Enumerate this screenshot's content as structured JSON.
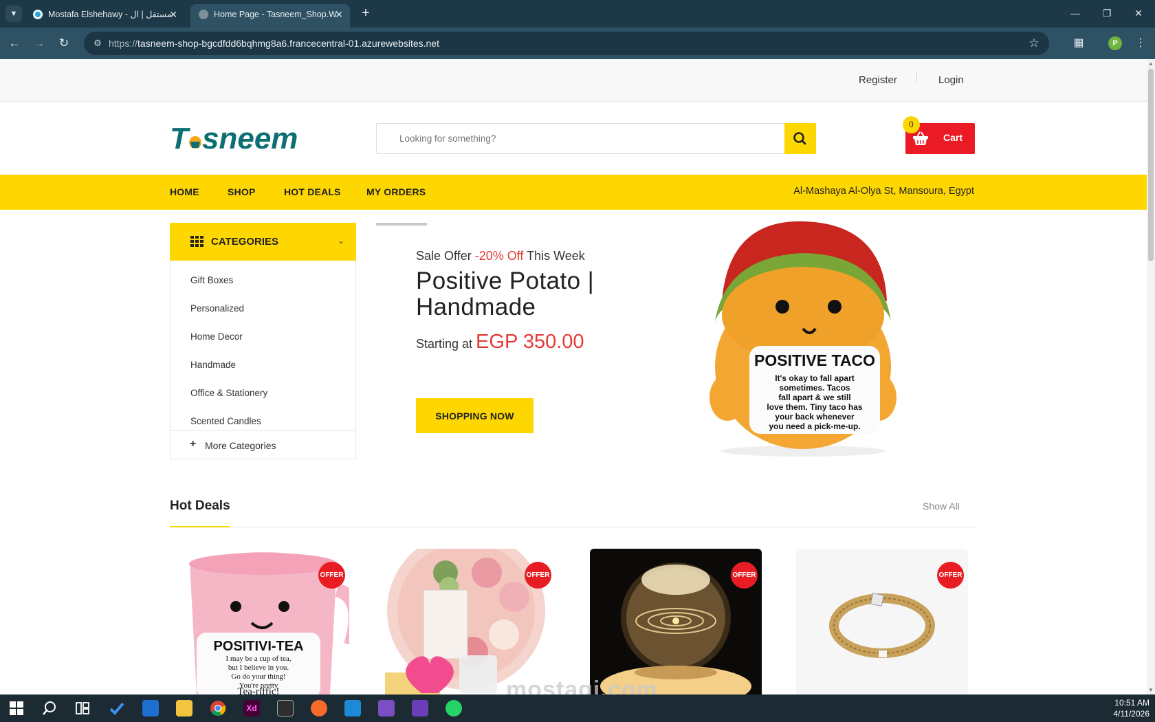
{
  "browser": {
    "tabs": [
      {
        "title": "Mostafa Elshehawy - مستقل | ال",
        "active": false
      },
      {
        "title": "Home Page - Tasneem_Shop.W",
        "active": true
      }
    ],
    "url_scheme": "https://",
    "url_host": "tasneem-shop-bgcdfdd6bqhmg8a6.francecentral-01.azurewebsites.net",
    "profile_initial": "P"
  },
  "topbar": {
    "register": "Register",
    "login": "Login"
  },
  "header": {
    "logo_text": "Tasneem",
    "search_placeholder": "Looking for something?",
    "cart_label": "Cart",
    "cart_count": "0"
  },
  "nav": {
    "items": [
      "HOME",
      "SHOP",
      "HOT DEALS",
      "MY ORDERS"
    ],
    "address": "Al-Mashaya Al-Olya St, Mansoura, Egypt"
  },
  "categories": {
    "title": "CATEGORIES",
    "items": [
      "Gift Boxes",
      "Personalized",
      "Home Decor",
      "Handmade",
      "Office & Stationery",
      "Scented Candles"
    ],
    "more": "More Categories"
  },
  "hero": {
    "pre_a": "Sale Offer ",
    "pre_off": "-20% Off",
    "pre_b": " This Week",
    "title": "Positive Potato | Handmade",
    "price_label": "Starting at ",
    "price": "EGP 350.00",
    "button": "SHOPPING NOW",
    "img_title": "POSITIVE TACO",
    "img_text": [
      "It's okay to fall apart",
      "sometimes. Tacos",
      "fall apart & we still",
      "love them. Tiny taco has",
      "your back whenever",
      "you need a pick-me-up."
    ]
  },
  "hot_deals": {
    "title": "Hot Deals",
    "show_all": "Show All",
    "badge": "OFFER",
    "products": [
      {
        "image": "positivi-tea-mug",
        "title": "POSITIVI-TEA",
        "text": [
          "I may be a cup of tea,",
          "but I believe in you.",
          "Go do your thing!",
          "You're pretty",
          "Tea-riffic!"
        ]
      },
      {
        "image": "rose-gift-box"
      },
      {
        "image": "crystal-ball-lamp"
      },
      {
        "image": "gold-bracelet"
      }
    ]
  },
  "watermark": "mostaqi.com",
  "taskbar": {
    "time": "10:51 AM",
    "date": "4/11/2026"
  }
}
